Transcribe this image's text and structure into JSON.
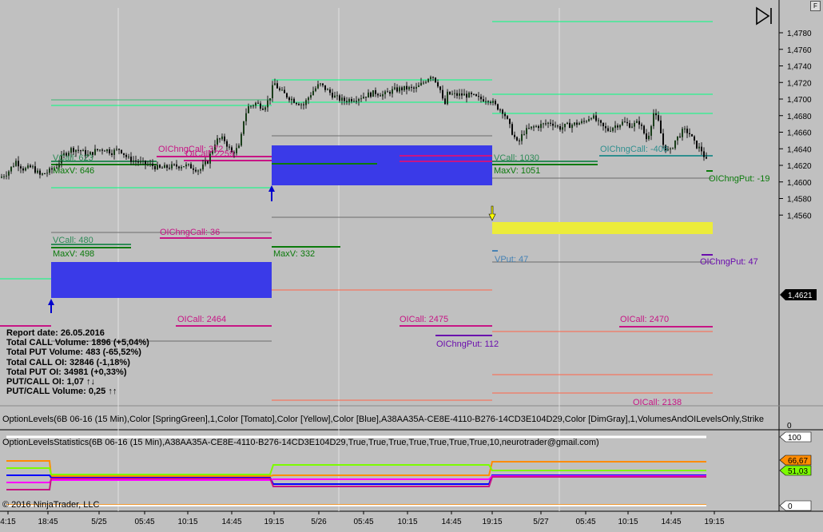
{
  "window": {
    "f_button": "F"
  },
  "price_panel": {
    "y_ticks": [
      "1,4780",
      "1,4760",
      "1,4740",
      "1,4720",
      "1,4700",
      "1,4680",
      "1,4660",
      "1,4640",
      "1,4620",
      "1,4600",
      "1,4580",
      "1,4560"
    ],
    "last_price": "1,4621",
    "bottom_label": "0"
  },
  "x_axis": {
    "ticks": [
      "4:15",
      "18:45",
      "5/25",
      "05:45",
      "10:15",
      "14:45",
      "19:15",
      "5/26",
      "05:45",
      "10:15",
      "14:45",
      "19:15",
      "5/27",
      "05:45",
      "10:15",
      "14:45",
      "19:15"
    ]
  },
  "level_labels": {
    "vcall_623": "VCall: 623",
    "maxv_646": "MaxV: 646",
    "oichng_call_372": "OIChngCall: 372",
    "oicall_2259": "OICall: 2259",
    "vcall_480": "VCall: 480",
    "maxv_498": "MaxV: 498",
    "oichng_call_36": "OIChngCall: 36",
    "maxv_332": "MaxV: 332",
    "oicall_2464": "OICall: 2464",
    "oicall_2475": "OICall: 2475",
    "oichng_put_112": "OIChngPut: 112",
    "vcall_1030": "VCall: 1030",
    "maxv_1051": "MaxV: 1051",
    "oichng_call_406": "OIChngCall: -406",
    "oichng_put_19": "OIChngPut: -19",
    "vput_47": "VPut: 47",
    "oichng_put_47": "OIChngPut: 47",
    "oicall_2470": "OICall: 2470",
    "oicall_2138": "OICall: 2138"
  },
  "report": {
    "date": "Report date: 26.05.2016",
    "total_call_volume": "Total CALL Volume: 1896 (+5,04%)",
    "total_put_volume": "Total PUT Volume: 483 (-65,52%)",
    "total_call_oi": "Total CALL OI: 32846 (-1,18%)",
    "total_put_oi": "Total PUT OI: 34981 (+0,33%)",
    "put_call_oi": "PUT/CALL OI: 1,07 ↑↓",
    "put_call_volume": "PUT/CALL Volume: 0,25 ↑↑"
  },
  "indicator_titles": {
    "option_levels": "OptionLevels(6B 06-16 (15 Min),Color [SpringGreen],1,Color [Tomato],Color [Yellow],Color [Blue],A38AA35A-CE8E-4110-B276-14CD3E104D29,Color [DimGray],1,VolumesAndOILevelsOnly,Strike",
    "option_levels_zero": "0",
    "option_levels_statistics": "OptionLevelsStatistics(6B 06-16 (15 Min),A38AA35A-CE8E-4110-B276-14CD3E104D29,True,True,True,True,True,True,True,10,neurotrader@gmail.com)"
  },
  "stats_panel": {
    "labels": [
      "100",
      "66,67",
      "51,03",
      "0"
    ],
    "badge_colors": [
      "#ffffff",
      "#ff8c00",
      "#7cfc00",
      "#ffffff"
    ]
  },
  "copyright": "© 2016 NinjaTrader, LLC",
  "colors": {
    "background": "#c0c0c0",
    "up_candle": "#1a3d1a",
    "blue_zone": "#3a3ae8",
    "yellow_zone": "#ecec3a",
    "vcall": "#2e8b57",
    "maxv": "#0b7a0b",
    "oichng_call": "#c71585",
    "oichng_put": "#6a0dad",
    "teal": "#2f8f8f",
    "tomato": "#ff6347",
    "spring_green": "#00ff7f"
  },
  "chart_data": {
    "type": "line",
    "series_kind": "candlestick price chart (6B 06-16, 15 Min)",
    "x_tick_labels": [
      "4:15",
      "18:45",
      "5/25",
      "05:45",
      "10:15",
      "14:45",
      "19:15",
      "5/26",
      "05:45",
      "10:15",
      "14:45",
      "19:15",
      "5/27",
      "05:45",
      "10:15",
      "14:45",
      "19:15"
    ],
    "ylim": [
      1.4545,
      1.4795
    ],
    "y_tick_values": [
      1.478,
      1.476,
      1.474,
      1.472,
      1.47,
      1.468,
      1.466,
      1.464,
      1.462,
      1.46,
      1.458,
      1.456
    ],
    "last_price": 1.4621,
    "close_path": [
      [
        0,
        1.4605
      ],
      [
        10,
        1.4612
      ],
      [
        20,
        1.4625
      ],
      [
        30,
        1.4615
      ],
      [
        40,
        1.4618
      ],
      [
        50,
        1.4608
      ],
      [
        60,
        1.4612
      ],
      [
        70,
        1.4618
      ],
      [
        80,
        1.4633
      ],
      [
        90,
        1.464
      ],
      [
        100,
        1.4638
      ],
      [
        110,
        1.4632
      ],
      [
        120,
        1.4638
      ],
      [
        130,
        1.464
      ],
      [
        140,
        1.4636
      ],
      [
        150,
        1.464
      ],
      [
        160,
        1.4628
      ],
      [
        170,
        1.4625
      ],
      [
        180,
        1.4622
      ],
      [
        190,
        1.462
      ],
      [
        200,
        1.4616
      ],
      [
        210,
        1.4618
      ],
      [
        220,
        1.4619
      ],
      [
        230,
        1.462
      ],
      [
        240,
        1.4618
      ],
      [
        250,
        1.4614
      ],
      [
        260,
        1.4625
      ],
      [
        270,
        1.465
      ],
      [
        280,
        1.4652
      ],
      [
        290,
        1.4635
      ],
      [
        300,
        1.4642
      ],
      [
        305,
        1.4675
      ],
      [
        310,
        1.469
      ],
      [
        320,
        1.4695
      ],
      [
        330,
        1.469
      ],
      [
        337,
        1.47
      ],
      [
        343,
        1.472
      ],
      [
        350,
        1.471
      ],
      [
        360,
        1.4703
      ],
      [
        370,
        1.4697
      ],
      [
        380,
        1.4693
      ],
      [
        390,
        1.4708
      ],
      [
        400,
        1.4718
      ],
      [
        410,
        1.471
      ],
      [
        420,
        1.4702
      ],
      [
        430,
        1.4698
      ],
      [
        440,
        1.47
      ],
      [
        450,
        1.4702
      ],
      [
        460,
        1.4705
      ],
      [
        470,
        1.4708
      ],
      [
        480,
        1.4705
      ],
      [
        490,
        1.471
      ],
      [
        500,
        1.4712
      ],
      [
        510,
        1.4713
      ],
      [
        520,
        1.4712
      ],
      [
        530,
        1.472
      ],
      [
        540,
        1.473
      ],
      [
        550,
        1.4715
      ],
      [
        556,
        1.469
      ],
      [
        560,
        1.4706
      ],
      [
        570,
        1.4705
      ],
      [
        580,
        1.4705
      ],
      [
        590,
        1.4704
      ],
      [
        600,
        1.47
      ],
      [
        612,
        1.47
      ],
      [
        620,
        1.4692
      ],
      [
        630,
        1.4685
      ],
      [
        640,
        1.4662
      ],
      [
        648,
        1.4645
      ],
      [
        655,
        1.466
      ],
      [
        665,
        1.4665
      ],
      [
        675,
        1.4668
      ],
      [
        690,
        1.4672
      ],
      [
        700,
        1.4665
      ],
      [
        710,
        1.4668
      ],
      [
        720,
        1.467
      ],
      [
        730,
        1.4672
      ],
      [
        740,
        1.468
      ],
      [
        750,
        1.467
      ],
      [
        760,
        1.4662
      ],
      [
        770,
        1.4668
      ],
      [
        780,
        1.4672
      ],
      [
        790,
        1.4668
      ],
      [
        800,
        1.4672
      ],
      [
        810,
        1.465
      ],
      [
        818,
        1.4683
      ],
      [
        824,
        1.4672
      ],
      [
        830,
        1.4645
      ],
      [
        838,
        1.4635
      ],
      [
        845,
        1.465
      ],
      [
        855,
        1.4662
      ],
      [
        862,
        1.466
      ],
      [
        870,
        1.4645
      ],
      [
        878,
        1.4638
      ],
      [
        886,
        1.4621
      ]
    ]
  }
}
